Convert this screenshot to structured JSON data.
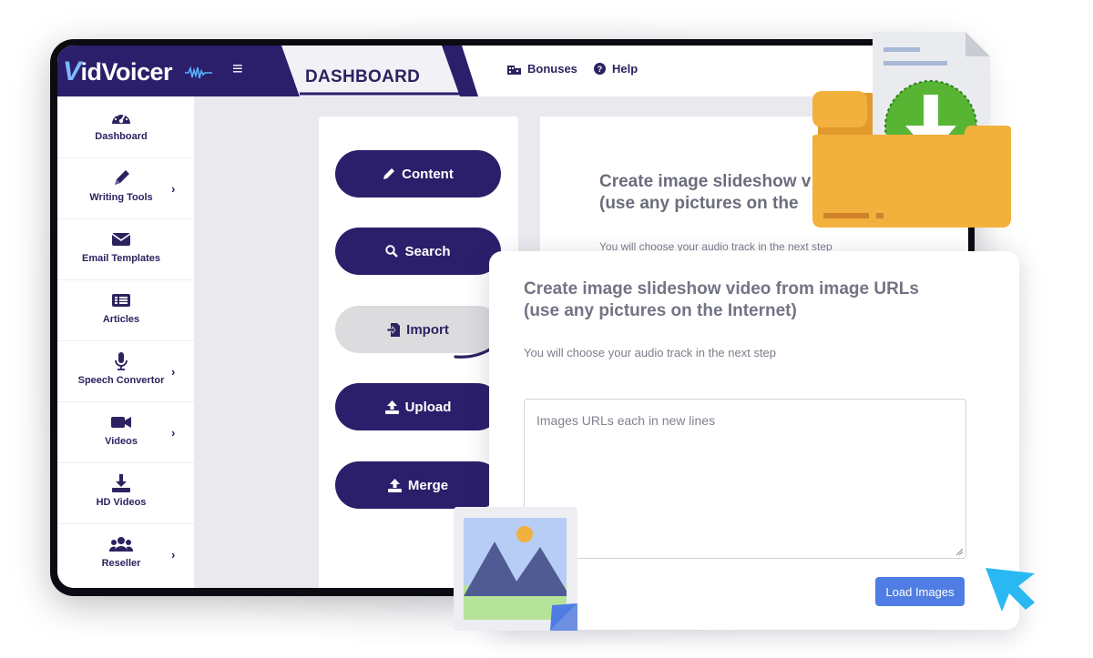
{
  "app": {
    "logo_v": "V",
    "logo_rest": "idVoicer",
    "menu_icon": "hamburger-icon",
    "section_tab": "DASHBOARD"
  },
  "topnav": [
    {
      "label": "Bonuses",
      "icon": "building-icon"
    },
    {
      "label": "Help",
      "icon": "question-circle-icon"
    }
  ],
  "sidebar": {
    "items": [
      {
        "label": "Dashboard",
        "icon": "gauge-icon",
        "has_submenu": false
      },
      {
        "label": "Writing Tools",
        "icon": "pencil-icon",
        "has_submenu": true
      },
      {
        "label": "Email Templates",
        "icon": "envelope-icon",
        "has_submenu": false
      },
      {
        "label": "Articles",
        "icon": "list-icon",
        "has_submenu": false
      },
      {
        "label": "Speech Convertor",
        "icon": "microphone-icon",
        "has_submenu": true
      },
      {
        "label": "Videos",
        "icon": "video-camera-icon",
        "has_submenu": true
      },
      {
        "label": "HD Videos",
        "icon": "download-icon",
        "has_submenu": false
      },
      {
        "label": "Reseller",
        "icon": "users-icon",
        "has_submenu": true
      }
    ]
  },
  "actions": [
    {
      "label": "Content",
      "icon": "pencil-icon",
      "active": true
    },
    {
      "label": "Search",
      "icon": "search-icon",
      "active": true
    },
    {
      "label": "Import",
      "icon": "file-import-icon",
      "active": false
    },
    {
      "label": "Upload",
      "icon": "upload-icon",
      "active": true
    },
    {
      "label": "Merge",
      "icon": "upload-icon",
      "active": true
    }
  ],
  "back_panel": {
    "title": "Create image slideshow video from image URLs (use any pictures on the Internet)",
    "title_line1": "Create image slideshow v",
    "title_line2": "(use any pictures on the",
    "subtitle": "You will choose your audio track in the next step"
  },
  "import_card": {
    "title_line1": "Create image slideshow video from image URLs",
    "title_line2": "(use any pictures on the Internet)",
    "subtitle": "You will choose your audio track in the next step",
    "textarea_placeholder": "Images URLs each in new lines",
    "load_button": "Load Images"
  },
  "decorations": {
    "folder_icon": "folder-download-icon",
    "image_icon": "image-landscape-icon",
    "arrow": "curved-arrow-icon",
    "cursor": "mouse-pointer-icon"
  },
  "colors": {
    "brand": "#2b1f6b",
    "accent_button": "#4f7de3",
    "folder": "#f2b03d",
    "download_green": "#58b534",
    "cursor": "#2ab8f2"
  }
}
